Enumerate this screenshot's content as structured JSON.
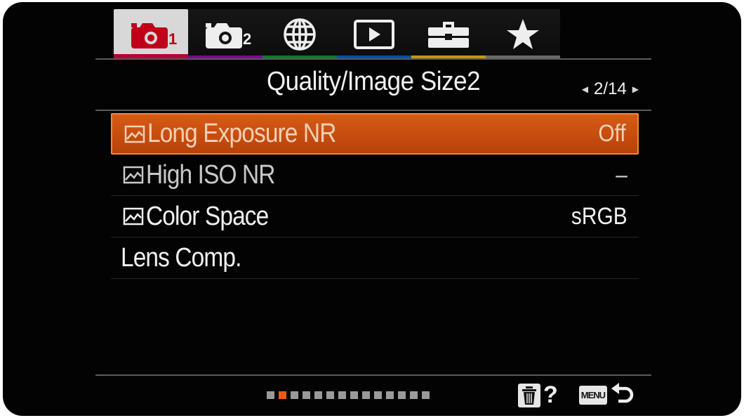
{
  "tabs": [
    {
      "name": "camera-settings-1",
      "icon": "camera-icon",
      "sub": "1",
      "color": "#b8003a",
      "active": true
    },
    {
      "name": "camera-settings-2",
      "icon": "camera-icon",
      "sub": "2",
      "color": "#7a0a8e",
      "active": false
    },
    {
      "name": "network",
      "icon": "globe-icon",
      "sub": "",
      "color": "#0a7a2a",
      "active": false
    },
    {
      "name": "playback",
      "icon": "play-icon",
      "sub": "",
      "color": "#0a4fa8",
      "active": false
    },
    {
      "name": "setup",
      "icon": "toolbox-icon",
      "sub": "",
      "color": "#c09a00",
      "active": false
    },
    {
      "name": "my-menu",
      "icon": "star-icon",
      "sub": "",
      "color": "#6a6a6a",
      "active": false
    }
  ],
  "header": {
    "title": "Quality/Image Size2",
    "page": "2/14"
  },
  "items": [
    {
      "label": "Long Exposure NR",
      "value": "Off",
      "icon": "still-image-icon",
      "selected": true,
      "dim": false
    },
    {
      "label": "High ISO NR",
      "value": "–",
      "icon": "still-image-icon",
      "selected": false,
      "dim": true
    },
    {
      "label": "Color Space",
      "value": "sRGB",
      "icon": "still-image-icon",
      "selected": false,
      "dim": false
    },
    {
      "label": "Lens Comp.",
      "value": "",
      "icon": "",
      "selected": false,
      "dim": false
    }
  ],
  "footer": {
    "page_count": 14,
    "current_page": 2,
    "help_symbol": "?",
    "menu_key_label": "MENU",
    "accent_color": "#ef5a10"
  }
}
